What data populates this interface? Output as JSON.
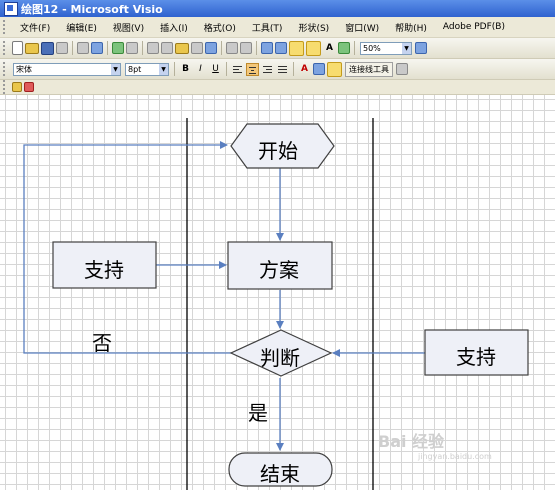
{
  "window": {
    "title": "绘图12 - Microsoft Visio"
  },
  "menu": [
    "文件(F)",
    "编辑(E)",
    "视图(V)",
    "插入(I)",
    "格式(O)",
    "工具(T)",
    "形状(S)",
    "窗口(W)",
    "帮助(H)",
    "Adobe PDF(B)"
  ],
  "toolbar": {
    "zoom": "50%",
    "font_name": "宋体",
    "font_size": "8pt",
    "bold": "B",
    "italic": "I",
    "underline": "U",
    "connector_label": "连接线工具",
    "font_color_label": "A"
  },
  "flowchart": {
    "start": "开始",
    "plan": "方案",
    "support_left": "支持",
    "support_right": "支持",
    "decision": "判断",
    "end": "结束",
    "no_label": "否",
    "yes_label": "是"
  },
  "watermark": {
    "brand": "Bai 经验",
    "url": "jingyan.baidu.com"
  },
  "colors": {
    "shape_fill": "#eef0f7",
    "shape_stroke": "#404040",
    "connector": "#5a7fc0",
    "swimlane": "#000000"
  }
}
